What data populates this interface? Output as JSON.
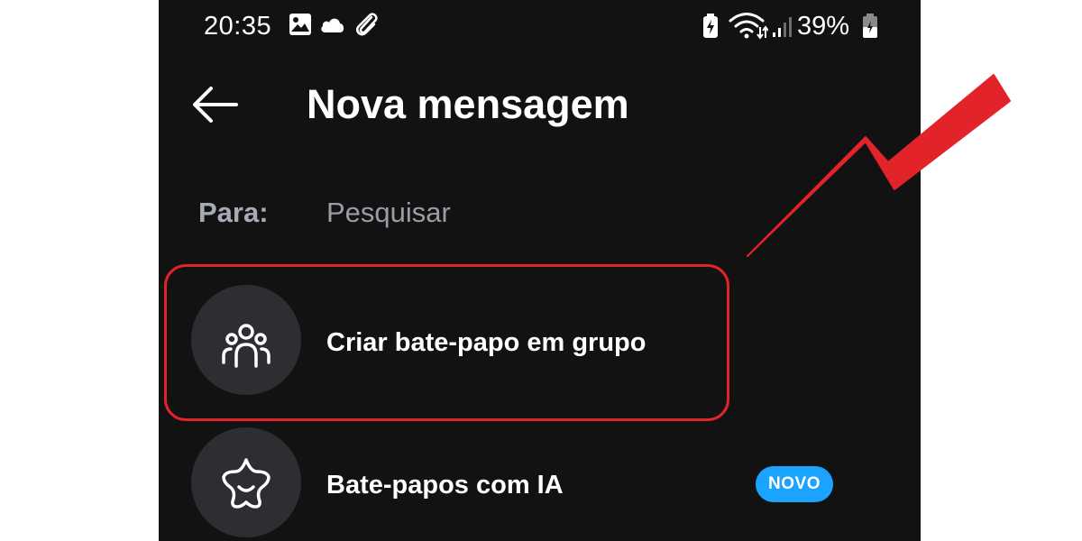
{
  "status_bar": {
    "time": "20:35",
    "left_icons": [
      "image-icon",
      "cloud-icon",
      "paperclip-icon"
    ],
    "right_icons": [
      "battery-saver-icon",
      "wifi-icon",
      "signal-icon",
      "battery-icon"
    ],
    "battery": "39%"
  },
  "header": {
    "title": "Nova mensagem",
    "back_icon": "back-arrow-icon"
  },
  "to_field": {
    "label": "Para:",
    "placeholder": "Pesquisar"
  },
  "list": {
    "items": [
      {
        "label": "Criar bate-papo em grupo",
        "icon": "group-icon"
      },
      {
        "label": "Bate-papos com IA",
        "icon": "ai-sparkle-icon",
        "badge": "NOVO"
      }
    ]
  },
  "colors": {
    "background": "#121212",
    "text": "#ffffff",
    "muted": "#a8abb3",
    "avatar_bg": "#2d2e32",
    "badge": "#1aa3ff",
    "annotation": "#e3232a"
  }
}
